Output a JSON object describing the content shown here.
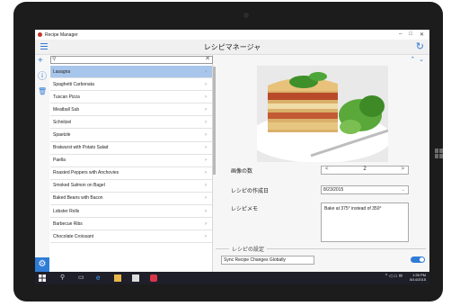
{
  "window": {
    "app_title": "Recipe Manager",
    "controls": [
      "–",
      "□",
      "✕"
    ]
  },
  "header": {
    "title": "レシピマネージャ"
  },
  "search": {
    "placeholder": ""
  },
  "recipes": [
    {
      "name": "Lasagna",
      "selected": true
    },
    {
      "name": "Spaghetti Carbonata"
    },
    {
      "name": "Tuscan Pizza"
    },
    {
      "name": "Meatball Sub"
    },
    {
      "name": "Schnitzel"
    },
    {
      "name": "Spaetzle"
    },
    {
      "name": "Bratwurst with Potato Salad"
    },
    {
      "name": "Paella"
    },
    {
      "name": "Roasted Peppers with Anchovies"
    },
    {
      "name": "Smoked Salmon on Bagel"
    },
    {
      "name": "Baked Beans with Bacon"
    },
    {
      "name": "Lobster Rolls"
    },
    {
      "name": "Barbecue Ribs"
    },
    {
      "name": "Chocolate Croissant"
    }
  ],
  "detail": {
    "images_label": "画像の数",
    "images_count": "2",
    "created_label": "レシピの作成日",
    "created_date": "8/23/2015",
    "memo_label": "レシピメモ",
    "memo_text": "Bake at 375° instead of 350°"
  },
  "settings": {
    "section_title": "レシピの設定",
    "sync_label": "Sync Recipe Changes Globally",
    "sync_on": true
  },
  "taskbar": {
    "time": "1:35 PM",
    "date": "8/14/2015"
  }
}
